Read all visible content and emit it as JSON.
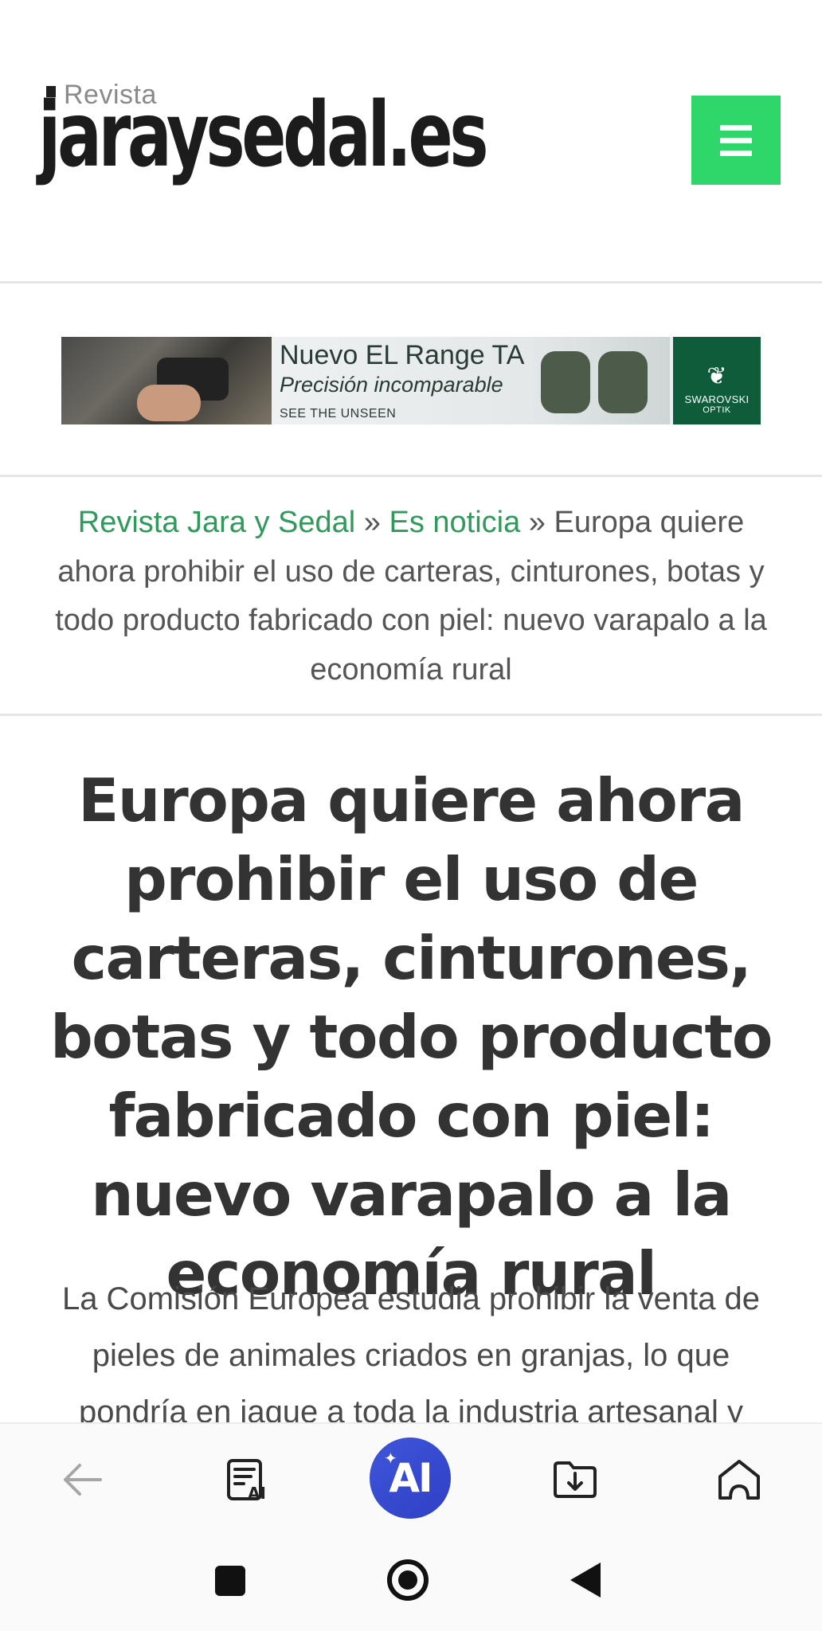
{
  "header": {
    "logo_kicker": "Revista",
    "logo_text": "jaraysedal.es",
    "menu_icon": "hamburger-menu-icon",
    "menu_color": "#2fd66a"
  },
  "ad": {
    "title": "Nuevo EL Range TA",
    "subtitle": "Precisión incomparable",
    "tagline": "SEE THE UNSEEN",
    "brand": "SWAROVSKI",
    "brand_sub": "OPTIK",
    "brand_color": "#0e5c3a"
  },
  "breadcrumb": {
    "home": "Revista Jara y Sedal",
    "sep1": " » ",
    "section": "Es noticia",
    "sep2": " » ",
    "current": "Europa quiere ahora prohibir el uso de carteras, cinturones, botas y todo producto fabricado con piel: nuevo varapalo a la economía rural",
    "link_color": "#2f9a5a"
  },
  "article": {
    "title": "Europa quiere ahora prohibir el uso de carteras, cinturones, botas y todo producto fabricado con piel: nuevo varapalo a la economía rural",
    "lead": "La Comisión Europea estudia prohibir la venta de pieles de animales criados en granjas, lo que pondría en jaque a toda la industria artesanal y"
  },
  "toolbar": {
    "back_icon": "arrow-left-icon",
    "reader_icon": "ai-reader-icon",
    "ai_label": "AI",
    "ai_color": "#3a4fd3",
    "download_icon": "folder-download-icon",
    "home_icon": "home-icon"
  },
  "navbar": {
    "recents_icon": "square-recents-icon",
    "home_icon": "circle-home-icon",
    "back_icon": "triangle-back-icon"
  }
}
